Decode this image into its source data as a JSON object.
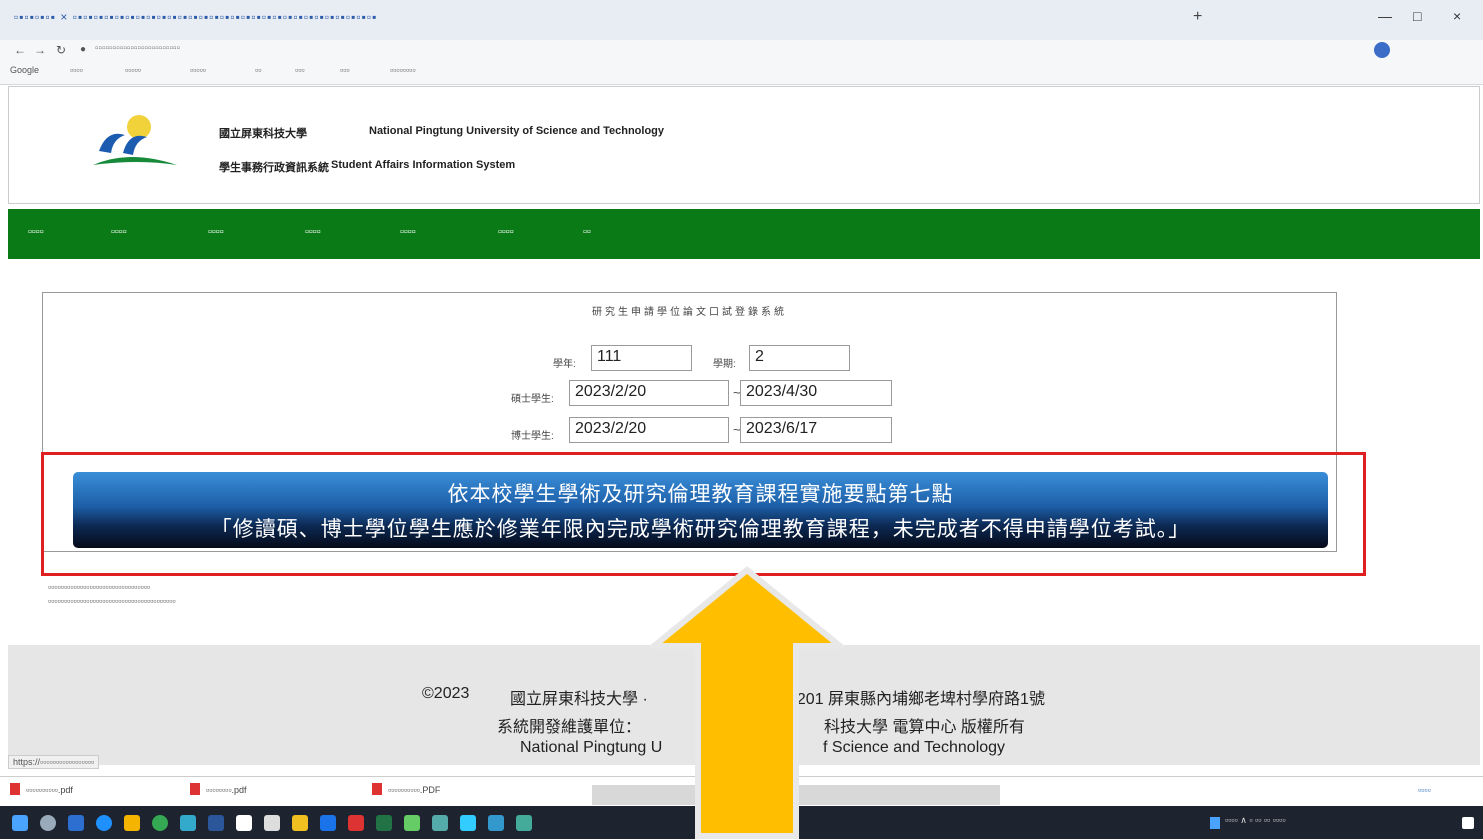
{
  "browser": {
    "tab_strip_text": "▫▪▫▪▫▪▫▪ × ▫▪▫▪▫▪▫▪▫▪▫▪▫▪▫▪▫▪▫▪▫▪▫▪▫▪▫▪▫▪▫▪▫▪▫▪▫▪▫▪▫▪▫▪▫▪▫▪▫▪▫▪▫▪▫▪▫▪",
    "new_tab": "+",
    "window_controls": {
      "minimize": "—",
      "maximize": "□",
      "close": "×"
    },
    "url": "▫▫▫▫▫▫▫▫▫▫▫▫▫▫▫▫▫▫▫▫▫▫▫▫",
    "bookmarks": [
      "Google",
      "▫▫▫▫",
      "▫▫▫▫▫",
      "▫▫▫▫▫",
      "▫▫",
      "▫▫▫",
      "▫▫▫",
      "▫▫▫▫▫▫▫▫"
    ]
  },
  "header": {
    "school_name_zh": "國立屏東科技大學",
    "school_name_en": "National Pingtung University of Science and Technology",
    "system_name_zh": "學生事務行政資訊系統",
    "system_name_en": "Student Affairs Information System"
  },
  "nav": {
    "items": [
      "▫▫▫▫",
      "▫▫▫▫",
      "▫▫▫▫",
      "▫▫▫▫",
      "▫▫▫▫",
      "▫▫▫▫",
      "▫▫"
    ]
  },
  "form": {
    "title": "研究生申請學位論文口試登錄系統",
    "year_label": "學年:",
    "year_value": "111",
    "term_label": "學期:",
    "term_value": "2",
    "master_label": "碩士學生:",
    "master_start": "2023/2/20",
    "master_end": "2023/4/30",
    "phd_label": "博士學生:",
    "phd_start": "2023/2/20",
    "phd_end": "2023/6/17",
    "tilde": "~"
  },
  "banner": {
    "line1": "依本校學生學術及研究倫理教育課程實施要點第七點",
    "line2": "「修讀碩、博士學位學生應於修業年限內完成學術研究倫理教育課程，未完成者不得申請學位考試。」"
  },
  "notes": {
    "line1": "▫▫▫▫▫▫▫▫▫▫▫▫▫▫▫▫▫▫▫▫▫▫▫▫▫▫▫▫▫▫▫▫",
    "line2": "▫▫▫▫▫▫▫▫▫▫▫▫▫▫▫▫▫▫▫▫▫▫▫▫▫▫▫▫▫▫▫▫▫▫▫▫▫▫▫▫"
  },
  "footer": {
    "line1_left": "©2023",
    "line1_mid": "國立屏東科技大學 ·",
    "line1_right": "1201 屏東縣內埔鄉老埤村學府路1號",
    "line2_left": "系統開發維護單位：",
    "line2_right": "科技大學 電算中心 版權所有",
    "line3_left": "National Pingtung U",
    "line3_right": "f Science and Technology"
  },
  "status_url": "https://▫▫▫▫▫▫▫▫▫▫▫▫▫▫▫▫▫",
  "downloads": [
    {
      "name": "▫▫▫▫▫▫▫▫▫▫.pdf"
    },
    {
      "name": "▫▫▫▫▫▫▫▫.pdf"
    },
    {
      "name": "▫▫▫▫▫▫▫▫▫▫.PDF"
    }
  ],
  "downloads_show_all": "▫▫▫▫",
  "tray": {
    "text": "▫▫▫▫  ∧  ▫ ▫▫ ▫▫  ▫▫▫▫"
  },
  "colors": {
    "nav_green": "#0a7a16",
    "banner_blue": "#1d5fa8",
    "highlight_red": "#e02020",
    "arrow_yellow": "#ffbf00"
  }
}
